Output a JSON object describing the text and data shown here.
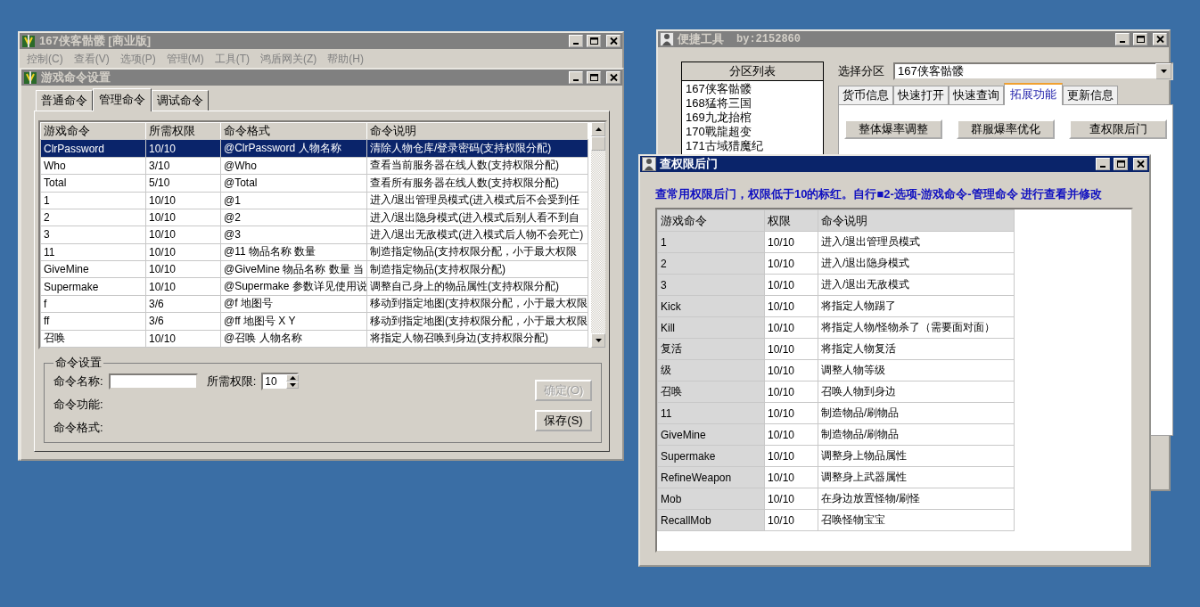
{
  "main_window": {
    "title": "167侠客骷髅 [商业版]",
    "active": false,
    "menu": [
      {
        "label": "控制(C)"
      },
      {
        "label": "查看(V)"
      },
      {
        "label": "选项(P)"
      },
      {
        "label": "管理(M)"
      },
      {
        "label": "工具(T)"
      },
      {
        "label": "鸿盾网关(Z)"
      },
      {
        "label": "帮助(H)"
      }
    ]
  },
  "command_window": {
    "title": "游戏命令设置",
    "active": false,
    "tabs": [
      {
        "label": "普通命令",
        "selected": false
      },
      {
        "label": "管理命令",
        "selected": true
      },
      {
        "label": "调试命令",
        "selected": false
      }
    ],
    "table": {
      "columns": [
        "游戏命令",
        "所需权限",
        "命令格式",
        "命令说明"
      ],
      "rows": [
        {
          "cells": [
            "ClrPassword",
            "10/10",
            "@ClrPassword 人物名称",
            "清除人物仓库/登录密码(支持权限分配)"
          ],
          "selected": true
        },
        {
          "cells": [
            "Who",
            "3/10",
            "@Who",
            "查看当前服务器在线人数(支持权限分配)"
          ],
          "selected": false
        },
        {
          "cells": [
            "Total",
            "5/10",
            "@Total",
            "查看所有服务器在线人数(支持权限分配)"
          ],
          "selected": false
        },
        {
          "cells": [
            "1",
            "10/10",
            "@1",
            "进入/退出管理员模式(进入模式后不会受到任"
          ],
          "selected": false
        },
        {
          "cells": [
            "2",
            "10/10",
            "@2",
            "进入/退出隐身模式(进入模式后别人看不到自"
          ],
          "selected": false
        },
        {
          "cells": [
            "3",
            "10/10",
            "@3",
            "进入/退出无敌模式(进入模式后人物不会死亡)"
          ],
          "selected": false
        },
        {
          "cells": [
            "11",
            "10/10",
            "@11 物品名称 数量",
            "制造指定物品(支持权限分配，小于最大权限"
          ],
          "selected": false
        },
        {
          "cells": [
            "GiveMine",
            "10/10",
            "@GiveMine 物品名称 数量 当",
            "制造指定物品(支持权限分配)"
          ],
          "selected": false
        },
        {
          "cells": [
            "Supermake",
            "10/10",
            "@Supermake 参数详见使用说",
            "调整自己身上的物品属性(支持权限分配)"
          ],
          "selected": false
        },
        {
          "cells": [
            "f",
            "3/6",
            "@f 地图号",
            "移动到指定地图(支持权限分配，小于最大权限"
          ],
          "selected": false
        },
        {
          "cells": [
            "ff",
            "3/6",
            "@ff 地图号 X Y",
            "移动到指定地图(支持权限分配，小于最大权限"
          ],
          "selected": false
        },
        {
          "cells": [
            "召唤",
            "10/10",
            "@召唤 人物名称",
            "将指定人物召唤到身边(支持权限分配)"
          ],
          "selected": false
        }
      ]
    },
    "settings": {
      "title": "命令设置",
      "name_label": "命令名称:",
      "level_label": "所需权限:",
      "level_value": "10",
      "function_label": "命令功能:",
      "format_label": "命令格式:",
      "buttons": [
        {
          "label": "确定(O)",
          "disabled": true
        },
        {
          "label": "保存(S)",
          "disabled": false
        }
      ]
    }
  },
  "tool_window": {
    "title": "便捷工具",
    "subtitle": "by:2152860",
    "active": false,
    "partition_list": {
      "header": "分区列表",
      "items": [
        "167侠客骷髅",
        "168猛将三国",
        "169九龙抬棺",
        "170戰龍超变",
        "171古域猎魔纪"
      ]
    },
    "select_label": "选择分区",
    "select_value": "167侠客骷髅",
    "tabs": [
      {
        "label": "货币信息",
        "selected": false
      },
      {
        "label": "快速打开",
        "selected": false
      },
      {
        "label": "快速查询",
        "selected": false
      },
      {
        "label": "拓展功能",
        "selected": true
      },
      {
        "label": "更新信息",
        "selected": false
      }
    ],
    "buttons": [
      "整体爆率调整",
      "群服爆率优化",
      "查权限后门"
    ]
  },
  "backdoor_window": {
    "title": "查权限后门",
    "active": true,
    "notice": "查常用权限后门，权限低于10的标红。自行■2-选项-游戏命令-管理命令 进行查看并修改",
    "table": {
      "columns": [
        "游戏命令",
        "权限",
        "命令说明"
      ],
      "rows": [
        [
          "1",
          "10/10",
          "进入/退出管理员模式"
        ],
        [
          "2",
          "10/10",
          "进入/退出隐身模式"
        ],
        [
          "3",
          "10/10",
          "进入/退出无敌模式"
        ],
        [
          "Kick",
          "10/10",
          "将指定人物踢了"
        ],
        [
          "Kill",
          "10/10",
          "将指定人物/怪物杀了（需要面对面）"
        ],
        [
          "复活",
          "10/10",
          "将指定人物复活"
        ],
        [
          "级",
          "10/10",
          "调整人物等级"
        ],
        [
          "召唤",
          "10/10",
          "召唤人物到身边"
        ],
        [
          "11",
          "10/10",
          "制造物品/刷物品"
        ],
        [
          "GiveMine",
          "10/10",
          "制造物品/刷物品"
        ],
        [
          "Supermake",
          "10/10",
          "调整身上物品属性"
        ],
        [
          "RefineWeapon",
          "10/10",
          "调整身上武器属性"
        ],
        [
          "Mob",
          "10/10",
          "在身边放置怪物/刷怪"
        ],
        [
          "RecallMob",
          "10/10",
          "召唤怪物宝宝"
        ]
      ]
    }
  }
}
